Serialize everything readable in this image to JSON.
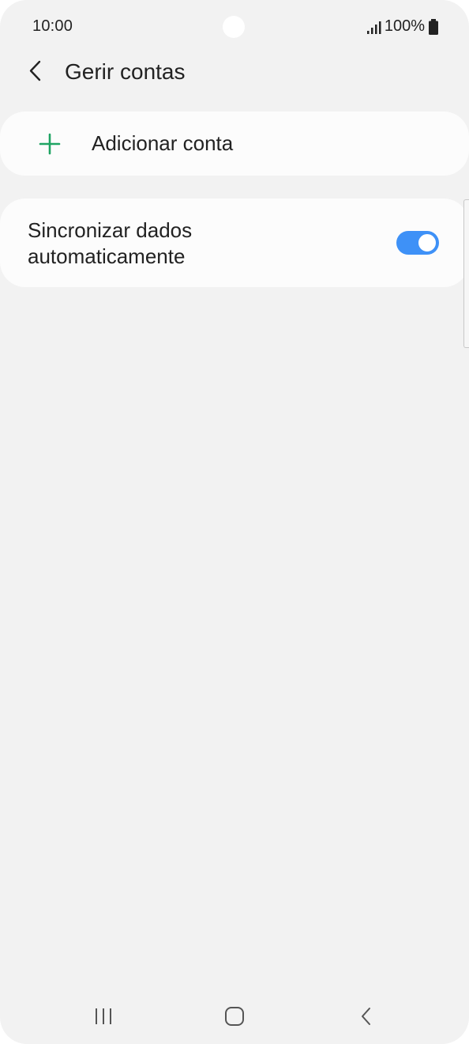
{
  "status_bar": {
    "time": "10:00",
    "battery": "100%",
    "icons": [
      "signal-icon",
      "battery-icon"
    ]
  },
  "header": {
    "title": "Gerir contas",
    "back_icon": "chevron-left-icon"
  },
  "add_account": {
    "label": "Adicionar conta",
    "icon": "plus-icon",
    "icon_color": "#1fa463"
  },
  "sync": {
    "label": "Sincronizar dados automaticamente",
    "enabled": true,
    "toggle_color": "#3e91f7"
  },
  "nav_bar": {
    "icons": [
      "recents-icon",
      "home-icon",
      "back-icon"
    ]
  }
}
